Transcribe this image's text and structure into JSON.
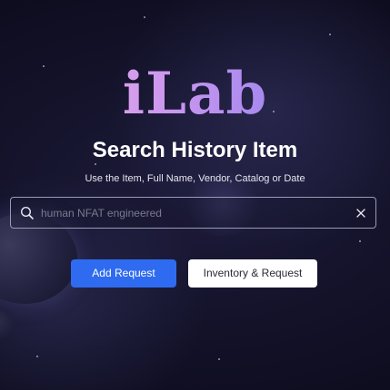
{
  "logo": {
    "text": "iLab"
  },
  "heading": {
    "title": "Search History Item",
    "subtitle": "Use the Item, Full Name, Vendor, Catalog or Date"
  },
  "search": {
    "value": "",
    "placeholder": "human NFAT engineered",
    "search_icon": "search-icon",
    "clear_icon": "close-icon"
  },
  "actions": {
    "add_request_label": "Add Request",
    "inventory_request_label": "Inventory & Request"
  },
  "colors": {
    "background": "#121127",
    "logo_gradient_start": "#f4b4e6",
    "logo_gradient_end": "#7b78f0",
    "primary_button": "#2f6bf0",
    "secondary_button": "#ffffff"
  }
}
